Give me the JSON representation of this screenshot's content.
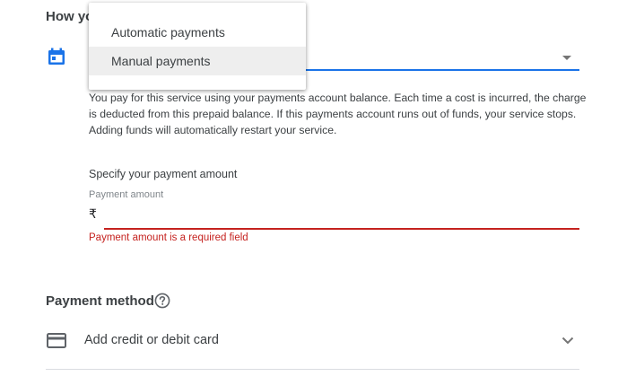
{
  "section": {
    "heading": "How yo"
  },
  "payment_type_select": {
    "options": [
      "Automatic payments",
      "Manual payments"
    ],
    "highlighted": "Manual payments"
  },
  "description": "You pay for this service using your payments account balance. Each time a cost is incurred, the charge is deducted from this prepaid balance. If this payments account runs out of funds, your service stops. Adding funds will automatically restart your service.",
  "amount": {
    "prompt": "Specify your payment amount",
    "label": "Payment amount",
    "currency_symbol": "₹",
    "value": "",
    "error": "Payment amount is a required field"
  },
  "payment_method": {
    "heading": "Payment method",
    "add_card_label": "Add credit or debit card"
  },
  "colors": {
    "accent": "#1a73e8",
    "error": "#c5221f",
    "text": "#3c4043"
  },
  "icons": [
    "calendar-icon",
    "dropdown-arrow-icon",
    "help-circle-icon",
    "credit-card-icon",
    "chevron-down-icon"
  ]
}
